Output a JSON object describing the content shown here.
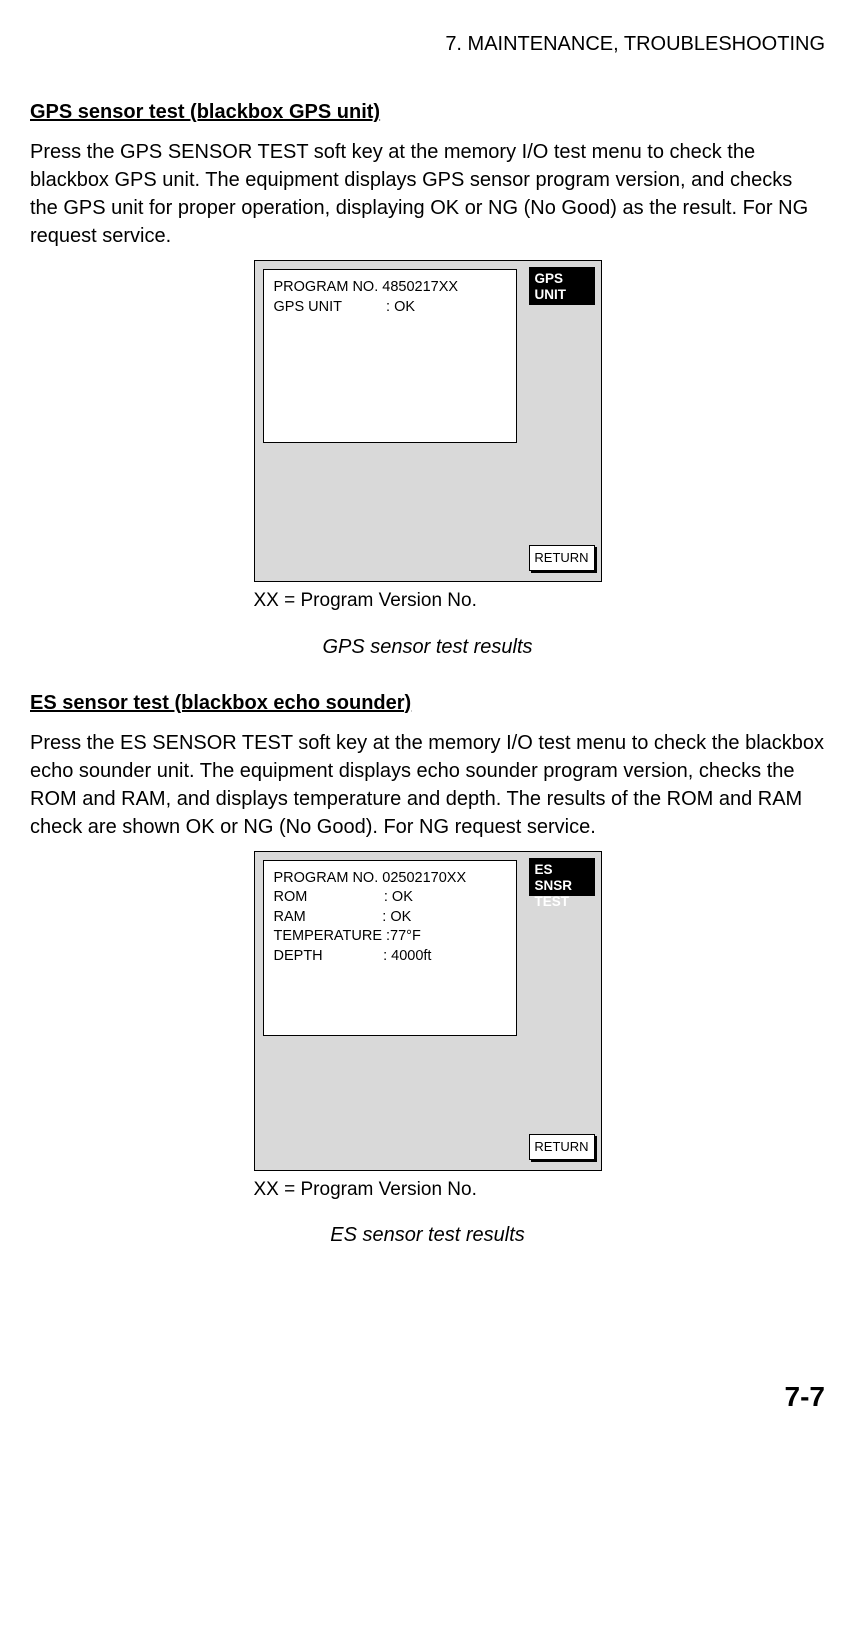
{
  "header": {
    "chapter": "7. MAINTENANCE, TROUBLESHOOTING"
  },
  "section1": {
    "heading": "GPS sensor test (blackbox GPS unit)",
    "body": "Press the GPS SENSOR TEST soft key at the memory I/O test menu to check the blackbox GPS unit. The equipment displays GPS sensor program version, and checks the GPS unit for proper operation, displaying OK or NG (No Good) as the result. For NG request service."
  },
  "screen1": {
    "lines": [
      "PROGRAM NO. 4850217XX",
      "GPS UNIT           : OK"
    ],
    "softkey_selected_line1": "GPS",
    "softkey_selected_line2": "UNIT",
    "return_label": "RETURN"
  },
  "figure1": {
    "note": "XX = Program Version No.",
    "caption": "GPS sensor test results"
  },
  "section2": {
    "heading": "ES sensor test (blackbox echo sounder)",
    "body": "Press the ES SENSOR TEST soft key at the memory I/O test menu to check the blackbox echo sounder unit. The equipment displays echo sounder program version, checks the ROM and RAM, and displays temperature and depth. The results of the ROM and RAM check are shown OK or NG (No Good). For NG request service."
  },
  "screen2": {
    "lines": [
      "PROGRAM NO. 02502170XX",
      "ROM                   : OK",
      "RAM                   : OK",
      "TEMPERATURE :77°F",
      "DEPTH               : 4000ft"
    ],
    "softkey_selected_line1": "ES SNSR",
    "softkey_selected_line2": "TEST",
    "return_label": "RETURN"
  },
  "figure2": {
    "note": "XX = Program Version No.",
    "caption": "ES sensor test results"
  },
  "footer": {
    "page_number": "7-7"
  }
}
